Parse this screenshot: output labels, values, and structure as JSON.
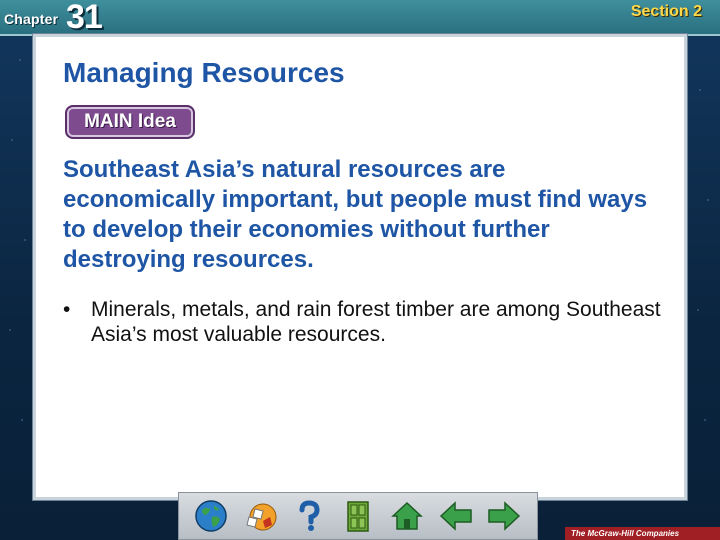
{
  "header": {
    "chapter_label": "Chapter",
    "chapter_number": "31",
    "section_label": "Section 2"
  },
  "slide": {
    "title": "Managing Resources",
    "badge": "MAIN Idea",
    "main_idea": "Southeast Asia’s natural resources are economically important, but people must find ways to develop their economies without further destroying resources.",
    "bullets": [
      {
        "dot": "•",
        "text": "Minerals, metals, and rain forest timber are among Southeast Asia’s most valuable resources."
      }
    ]
  },
  "nav": {
    "buttons": [
      {
        "icon": "globe-icon"
      },
      {
        "icon": "puzzle-pieces-icon"
      },
      {
        "icon": "question-mark-icon"
      },
      {
        "icon": "door-icon"
      },
      {
        "icon": "home-icon"
      },
      {
        "icon": "arrow-left-icon"
      },
      {
        "icon": "arrow-right-icon"
      }
    ]
  },
  "publisher": "The McGraw-Hill Companies",
  "colors": {
    "title_blue": "#1e55a5",
    "badge_purple": "#7e4c8e",
    "header_teal": "#2a6f80",
    "section_yellow": "#ffd94a",
    "nav_green": "#3aa04a",
    "publisher_red": "#a01f24"
  }
}
